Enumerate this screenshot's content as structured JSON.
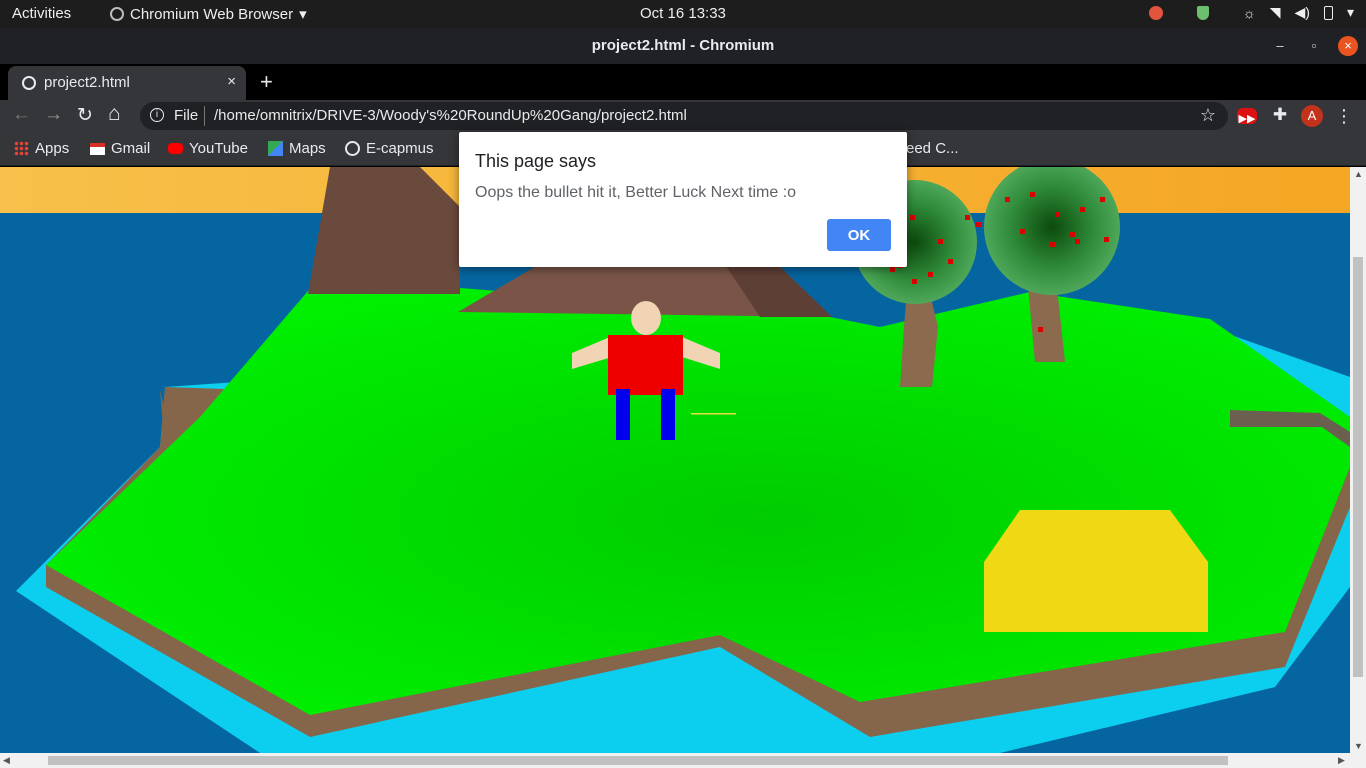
{
  "topbar": {
    "activities": "Activities",
    "app_menu": "Chromium Web Browser",
    "clock": "Oct 16  13:33"
  },
  "window": {
    "title": "project2.html - Chromium"
  },
  "tab": {
    "label": "project2.html",
    "close": "×",
    "new_tab": "+"
  },
  "toolbar": {
    "back": "←",
    "forward": "→",
    "reload": "↻",
    "home": "⌂",
    "scheme": "File",
    "url": "/home/omnitrix/DRIVE-3/Woody's%20RoundUp%20Gang/project2.html",
    "star": "☆",
    "avatar_letter": "A",
    "menu": "⋮"
  },
  "bookmarks": {
    "items": [
      {
        "label": "Apps",
        "icon": "apps-grid-icon",
        "color": "#4285f4"
      },
      {
        "label": "Gmail",
        "icon": "gmail-icon",
        "color": "#d93025"
      },
      {
        "label": "YouTube",
        "icon": "youtube-icon",
        "color": "#ff0000"
      },
      {
        "label": "Maps",
        "icon": "maps-icon",
        "color": "#34a853"
      },
      {
        "label": "E-capmus",
        "icon": "globe-icon",
        "color": "#e8eaed"
      }
    ],
    "overflow_fragment": "eed C..."
  },
  "dialog": {
    "title": "This page says",
    "message": "Oops the bullet hit it, Better Luck Next time :o",
    "ok": "OK"
  },
  "colors": {
    "sky": "#f5a623",
    "sea": "#0565a0",
    "island_grass": "#00ee00",
    "island_edge": "#85664a",
    "shore": "#0ccff0",
    "sand": "#f0dc10",
    "player_shirt": "#ee0000",
    "player_legs": "#0000ee",
    "player_skin": "#f0d4b4"
  }
}
